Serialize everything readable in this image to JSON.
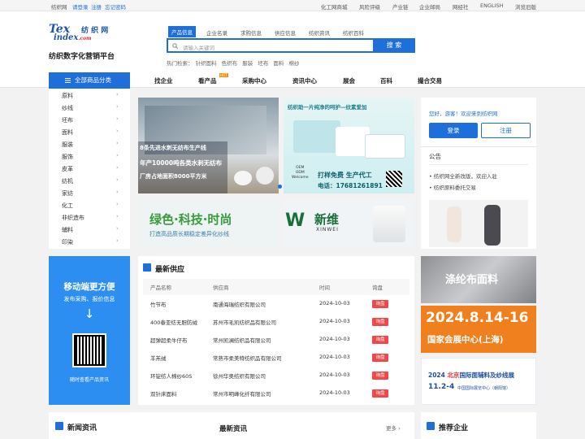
{
  "topbar": {
    "brand": "纺织网",
    "login": "请登录",
    "register": "注册",
    "forgot": "忘记密码",
    "links": [
      "化工网商城",
      "风险评级",
      "产业链",
      "企业邮局",
      "网经社",
      "ENGLISH",
      "浏览旧版"
    ]
  },
  "logo": {
    "tex": "Tex",
    "index": "index",
    "com": ".com",
    "cn_name": "纺 织 网"
  },
  "tagline": "纺织数字化营销平台",
  "search": {
    "tabs": [
      "产品信息",
      "企业名录",
      "求购信息",
      "供应信息",
      "纺织资讯",
      "纺织百科"
    ],
    "placeholder": "请输入关键词",
    "button": "搜 索",
    "hot_label": "热门检索：",
    "hot": [
      "针织面料",
      "色织布",
      "服装",
      "坯布",
      "面料",
      "棉纱"
    ]
  },
  "nav": {
    "all_categories": "全部商品分类",
    "items": [
      "找企业",
      "看产品",
      "采购中心",
      "资讯中心",
      "展会",
      "百科",
      "撮合交易"
    ],
    "hot_badge": "HOT"
  },
  "categories": [
    "原料",
    "纱线",
    "坯布",
    "面料",
    "服装",
    "服饰",
    "皮革",
    "纺机",
    "家纺",
    "化工",
    "非织造布",
    "辅料",
    "印染"
  ],
  "banners": {
    "b1_line1": "8条先进水刺无纺布生产线",
    "b1_line2": "年产10000吨各类水刺无纺布",
    "b1_line3": "厂房占地面积8000平方米",
    "b2_title": "纺织助一片纯净的呵护—纹素爱加",
    "b2_sub1": "打样免费 生产代工",
    "b2_sub2": "电话：17681261891",
    "b2_oem": "OEM",
    "b2_odm": "ODM",
    "b2_welcome": "Welcome",
    "b3_title": "绿色·科技·时尚",
    "b3_sub": "打造高品质长期稳定差异化纱线",
    "b4_cn": "新维",
    "b4_en": "XINWEI"
  },
  "user": {
    "greeting": "您好，游客！欢迎来到纺织网",
    "login": "登录",
    "register": "注册",
    "notice_title": "公告",
    "notices": [
      "纺织网全新改版，欢迎入驻",
      "纺织原料委托交易"
    ]
  },
  "mobile": {
    "title": "移动端更方便",
    "sub": "发布采购、报价信息",
    "arrow": "↓",
    "qr_caption": "随时查看产品资讯"
  },
  "supply": {
    "title": "最新供应",
    "headers": [
      "产品名称",
      "供应商",
      "时间",
      "询盘"
    ],
    "rows": [
      {
        "name": "竹节布",
        "supplier": "南通海瑞纺织有限公司",
        "date": "2024-10-03",
        "action": "询盘"
      },
      {
        "name": "400春亚纺无胆防绒",
        "supplier": "苏州市毛凯纺织品有限公司",
        "date": "2024-10-03",
        "action": "询盘"
      },
      {
        "name": "超弹超柔牛仔布",
        "supplier": "常州凯澜纺织品有限公司",
        "date": "2024-10-03",
        "action": "询盘"
      },
      {
        "name": "羊羔绒",
        "supplier": "常熟市柔美特纺织品有限公司",
        "date": "2024-10-03",
        "action": "询盘"
      },
      {
        "name": "环锭纺人棉纱60S",
        "supplier": "徐州华奥纺织有限公司",
        "date": "2024-10-03",
        "action": "询盘"
      },
      {
        "name": "双针床面料",
        "supplier": "常州市明峰化纤有限公司",
        "date": "2024-10-03",
        "action": "询盘"
      }
    ]
  },
  "side_ads": {
    "a1": "涤纶布面料",
    "a2_date": "2024.8.14-16",
    "a2_venue": "国家会展中心(上海)",
    "a3_title_pre": "2024 ",
    "a3_title_city": "北京",
    "a3_title": "国际面辅料及纱线展",
    "a3_date": "11.2-4",
    "a3_venue": "中国国际展览中心（朝阳馆）"
  },
  "bottom": {
    "news_title": "新闻资讯",
    "latest_title": "最新资讯",
    "more": "更多",
    "recommend_title": "推荐企业"
  }
}
